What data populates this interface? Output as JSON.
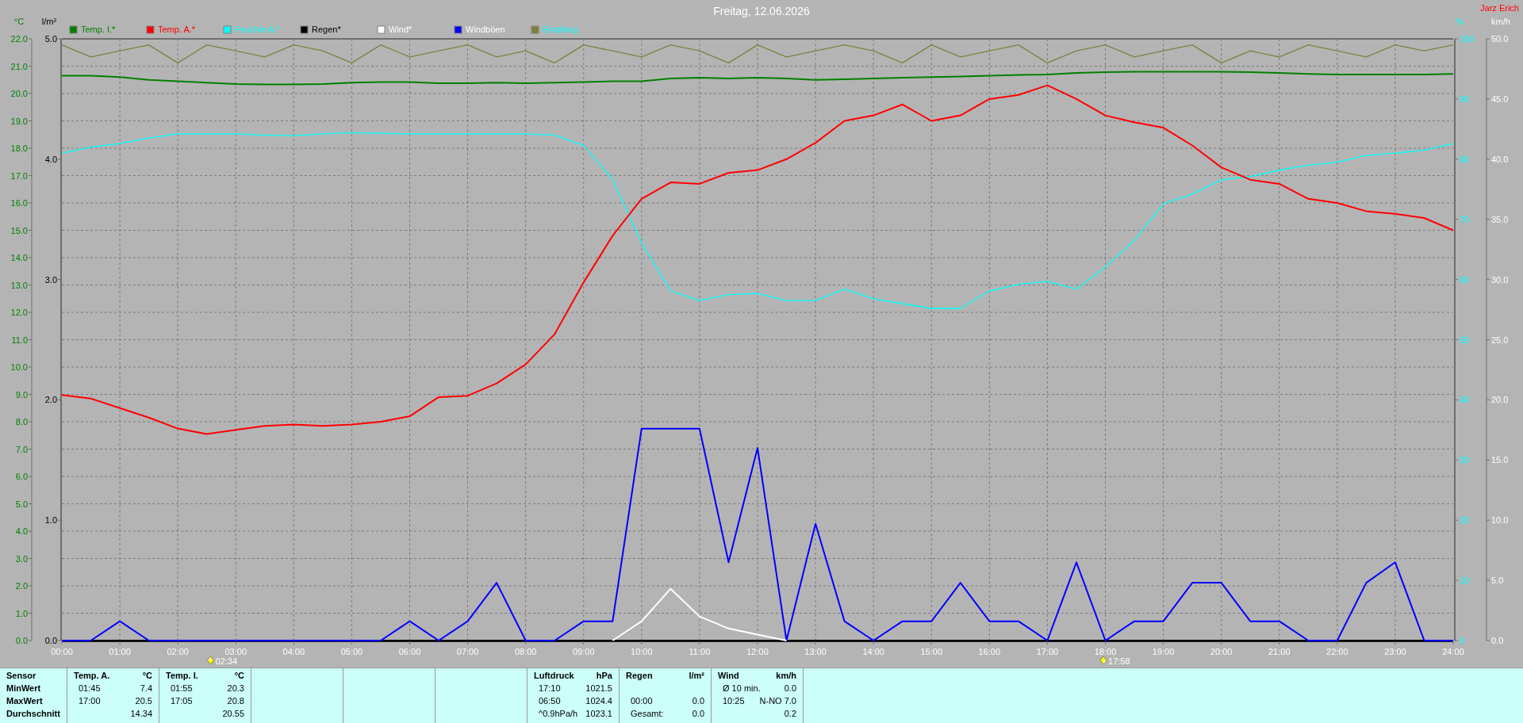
{
  "title": "Freitag, 12.06.2026",
  "author": "Jarz Erich",
  "rain_axis": {
    "unit": "l/m²",
    "ticks": [
      "5.0",
      "4.0",
      "3.0",
      "2.0",
      "1.0",
      "0.0"
    ]
  },
  "sun_times": [
    {
      "kind": "sunrise",
      "time": "02:34"
    },
    {
      "kind": "sunset",
      "time": "17:58"
    }
  ],
  "chart_data": {
    "type": "line",
    "x": [
      0,
      0.5,
      1,
      1.5,
      2,
      2.5,
      3,
      3.5,
      4,
      4.5,
      5,
      5.5,
      6,
      6.5,
      7,
      7.5,
      8,
      8.5,
      9,
      9.5,
      10,
      10.5,
      11,
      11.5,
      12,
      12.5,
      13,
      13.5,
      14,
      14.5,
      15,
      15.5,
      16,
      16.5,
      17,
      17.5,
      18,
      18.5,
      19,
      19.5,
      20,
      20.5,
      21,
      21.5,
      22,
      22.5,
      23,
      23.5,
      24
    ],
    "xlim": [
      0,
      24
    ],
    "xticks": [
      {
        "value": 0,
        "label": "00:00"
      },
      {
        "value": 1,
        "label": "01:00"
      },
      {
        "value": 2,
        "label": "02:00"
      },
      {
        "value": 3,
        "label": "03:00"
      },
      {
        "value": 4,
        "label": "04:00"
      },
      {
        "value": 5,
        "label": "05:00"
      },
      {
        "value": 6,
        "label": "06:00"
      },
      {
        "value": 7,
        "label": "07:00"
      },
      {
        "value": 8,
        "label": "08:00"
      },
      {
        "value": 9,
        "label": "09:00"
      },
      {
        "value": 10,
        "label": "10:00"
      },
      {
        "value": 11,
        "label": "11:00"
      },
      {
        "value": 12,
        "label": "12:00"
      },
      {
        "value": 13,
        "label": "13:00"
      },
      {
        "value": 14,
        "label": "14:00"
      },
      {
        "value": 15,
        "label": "15:00"
      },
      {
        "value": 16,
        "label": "16:00"
      },
      {
        "value": 17,
        "label": "17:00"
      },
      {
        "value": 18,
        "label": "18:00"
      },
      {
        "value": 19,
        "label": "19:00"
      },
      {
        "value": 20,
        "label": "20:00"
      },
      {
        "value": 21,
        "label": "21:00"
      },
      {
        "value": 22,
        "label": "22:00"
      },
      {
        "value": 23,
        "label": "23:00"
      },
      {
        "value": 24,
        "label": "24:00"
      }
    ],
    "ylabel": "°C",
    "ylim": [
      0,
      22
    ],
    "yticks": [
      {
        "value": 0,
        "label": "0.0"
      },
      {
        "value": 1,
        "label": "1.0"
      },
      {
        "value": 2,
        "label": "2.0"
      },
      {
        "value": 3,
        "label": "3.0"
      },
      {
        "value": 4,
        "label": "4.0"
      },
      {
        "value": 5,
        "label": "5.0"
      },
      {
        "value": 6,
        "label": "6.0"
      },
      {
        "value": 7,
        "label": "7.0"
      },
      {
        "value": 8,
        "label": "8.0"
      },
      {
        "value": 9,
        "label": "9.0"
      },
      {
        "value": 10,
        "label": "10.0"
      },
      {
        "value": 11,
        "label": "11.0"
      },
      {
        "value": 12,
        "label": "12.0"
      },
      {
        "value": 13,
        "label": "13.0"
      },
      {
        "value": 14,
        "label": "14.0"
      },
      {
        "value": 15,
        "label": "15.0"
      },
      {
        "value": 16,
        "label": "16.0"
      },
      {
        "value": 17,
        "label": "17.0"
      },
      {
        "value": 18,
        "label": "18.0"
      },
      {
        "value": 19,
        "label": "19.0"
      },
      {
        "value": 20,
        "label": "20.0"
      },
      {
        "value": 21,
        "label": "21.0"
      },
      {
        "value": 22,
        "label": "22.0"
      }
    ],
    "y2label": "%",
    "y2lim": [
      0,
      100
    ],
    "y2ticks": [
      {
        "value": 0,
        "label": "0"
      },
      {
        "value": 10,
        "label": "10"
      },
      {
        "value": 20,
        "label": "20"
      },
      {
        "value": 30,
        "label": "30"
      },
      {
        "value": 40,
        "label": "40"
      },
      {
        "value": 50,
        "label": "50"
      },
      {
        "value": 60,
        "label": "60"
      },
      {
        "value": 70,
        "label": "70"
      },
      {
        "value": 80,
        "label": "80"
      },
      {
        "value": 90,
        "label": "90"
      },
      {
        "value": 100,
        "label": "100"
      }
    ],
    "y3label": "km/h",
    "y3lim": [
      0,
      50
    ],
    "y3ticks": [
      {
        "value": 0,
        "label": "0.0"
      },
      {
        "value": 5,
        "label": "5.0"
      },
      {
        "value": 10,
        "label": "10.0"
      },
      {
        "value": 15,
        "label": "15.0"
      },
      {
        "value": 20,
        "label": "20.0"
      },
      {
        "value": 25,
        "label": "25.0"
      },
      {
        "value": 30,
        "label": "30.0"
      },
      {
        "value": 35,
        "label": "35.0"
      },
      {
        "value": 40,
        "label": "40.0"
      },
      {
        "value": 45,
        "label": "45.0"
      },
      {
        "value": 50,
        "label": "50.0"
      }
    ],
    "series": [
      {
        "name": "Temp. I.*",
        "color": "#008000",
        "values": [
          20.65,
          20.65,
          20.6,
          20.5,
          20.45,
          20.4,
          20.35,
          20.33,
          20.33,
          20.35,
          20.4,
          20.42,
          20.42,
          20.38,
          20.38,
          20.4,
          20.38,
          20.4,
          20.42,
          20.45,
          20.45,
          20.55,
          20.58,
          20.55,
          20.58,
          20.55,
          20.5,
          20.52,
          20.55,
          20.58,
          20.6,
          20.62,
          20.65,
          20.68,
          20.7,
          20.75,
          20.78,
          20.8,
          20.8,
          20.8,
          20.8,
          20.78,
          20.75,
          20.72,
          20.7,
          20.7,
          20.7,
          20.7,
          20.72
        ]
      },
      {
        "name": "Temp. A.*",
        "color": "#ff0000",
        "values": [
          8.98,
          8.85,
          8.5,
          8.15,
          7.75,
          7.55,
          7.7,
          7.85,
          7.9,
          7.85,
          7.9,
          8.0,
          8.2,
          8.9,
          8.95,
          9.4,
          10.1,
          11.2,
          13.1,
          14.8,
          16.15,
          16.75,
          16.7,
          17.1,
          17.2,
          17.6,
          18.2,
          19.0,
          19.2,
          19.6,
          19.0,
          19.2,
          19.8,
          19.95,
          20.3,
          19.8,
          19.2,
          18.95,
          18.75,
          18.1,
          17.3,
          16.85,
          16.7,
          16.15,
          16.0,
          15.7,
          15.6,
          15.45,
          15.0
        ]
      },
      {
        "name": "Feuchte A.*",
        "color": "#00ffff",
        "axis": "y2",
        "values": [
          81,
          82,
          82.6,
          83.5,
          84.2,
          84.2,
          84.2,
          84,
          83.9,
          84.2,
          84.4,
          84.3,
          84.2,
          84.2,
          84.2,
          84.2,
          84.2,
          84,
          82.3,
          76.6,
          66.1,
          58.1,
          56.5,
          57.5,
          57.7,
          56.5,
          56.5,
          58.4,
          56.8,
          56,
          55.2,
          55.2,
          58.1,
          59.2,
          59.7,
          58.4,
          62.1,
          66.5,
          72.6,
          74.2,
          76.6,
          77.1,
          78.2,
          79,
          79.5,
          80.6,
          81,
          81.5,
          82.6
        ]
      },
      {
        "name": "Regen*",
        "color": "#000000",
        "values": [
          0,
          0,
          0,
          0,
          0,
          0,
          0,
          0,
          0,
          0,
          0,
          0,
          0,
          0,
          0,
          0,
          0,
          0,
          0,
          0,
          0,
          0,
          0,
          0,
          0,
          0,
          0,
          0,
          0,
          0,
          0,
          0,
          0,
          0,
          0,
          0,
          0,
          0,
          0,
          0,
          0,
          0,
          0,
          0,
          0,
          0,
          0,
          0,
          0
        ]
      },
      {
        "name": "Wind*",
        "color": "#ffffff",
        "axis": "y3",
        "values": [
          null,
          null,
          null,
          null,
          null,
          null,
          null,
          null,
          null,
          null,
          null,
          null,
          null,
          null,
          null,
          null,
          null,
          null,
          null,
          0,
          1.6,
          4.3,
          2.0,
          1.0,
          0.5,
          0,
          null,
          null,
          null,
          null,
          null,
          null,
          null,
          null,
          null,
          null,
          null,
          null,
          null,
          null,
          null,
          null,
          null,
          null,
          null,
          null,
          null,
          null,
          null
        ]
      },
      {
        "name": "Windböen",
        "color": "#0000ff",
        "axis": "y3",
        "values": [
          0,
          0,
          1.6,
          0,
          0,
          0,
          0,
          0,
          0,
          0,
          0,
          0,
          1.6,
          0,
          1.6,
          4.8,
          0,
          0,
          1.6,
          1.6,
          17.6,
          17.6,
          17.6,
          6.5,
          16,
          0,
          9.7,
          1.6,
          0,
          1.6,
          1.6,
          4.8,
          1.6,
          1.6,
          0,
          6.5,
          0,
          1.6,
          1.6,
          4.8,
          4.8,
          1.6,
          1.6,
          0,
          0,
          4.8,
          6.5,
          0,
          0
        ]
      },
      {
        "name": "Empfang",
        "color": "#808040",
        "axis": "y2",
        "values": [
          99,
          97,
          98,
          99,
          96,
          99,
          98,
          97,
          99,
          98,
          96,
          99,
          97,
          98,
          99,
          97,
          98,
          96,
          99,
          98,
          97,
          99,
          98,
          96,
          99,
          97,
          98,
          99,
          98,
          96,
          99,
          97,
          98,
          99,
          96,
          98,
          99,
          97,
          98,
          99,
          96,
          98,
          97,
          99,
          98,
          97,
          99,
          98,
          99
        ]
      }
    ],
    "grid": true,
    "legend": true
  },
  "summary_table": [
    {
      "kind": "data",
      "header": {
        "title": "Sensor"
      },
      "rows": [
        {
          "label": "MinWert"
        },
        {
          "label": "MaxWert"
        },
        {
          "label": "Durchschnitt"
        }
      ]
    },
    {
      "kind": "data",
      "header": {
        "title": "Temp. A.",
        "unit": "°C"
      },
      "rows": [
        {
          "time": "01:45",
          "value": "7.4"
        },
        {
          "time": "17:00",
          "value": "20.5"
        },
        {
          "value": "14.34"
        }
      ]
    },
    {
      "kind": "data",
      "header": {
        "title": "Temp. I.",
        "unit": "°C"
      },
      "rows": [
        {
          "time": "01:55",
          "value": "20.3"
        },
        {
          "time": "17:05",
          "value": "20.8"
        },
        {
          "value": "20.55"
        }
      ]
    },
    {
      "kind": "empty"
    },
    {
      "kind": "empty"
    },
    {
      "kind": "empty"
    },
    {
      "kind": "data",
      "header": {
        "title": "Luftdruck",
        "unit": "hPa"
      },
      "rows": [
        {
          "time": "17:10",
          "value": "1021.5"
        },
        {
          "time": "06:50",
          "value": "1024.4"
        },
        {
          "time": "^0.9hPa/h",
          "value": "1023.1"
        }
      ]
    },
    {
      "kind": "data",
      "header": {
        "title": "Regen",
        "unit": "l/m²"
      },
      "rows": [
        {},
        {
          "time": "00:00",
          "value": "0.0"
        },
        {
          "time": "Gesamt:",
          "value": "0.0"
        }
      ]
    },
    {
      "kind": "data",
      "header": {
        "title": "Wind",
        "unit": "km/h"
      },
      "rows": [
        {
          "time": "Ø 10 min.",
          "value": "0.0"
        },
        {
          "time": "10:25",
          "value": "N-NO 7.0"
        },
        {
          "value": "0.2"
        }
      ]
    },
    {
      "kind": "empty"
    }
  ]
}
